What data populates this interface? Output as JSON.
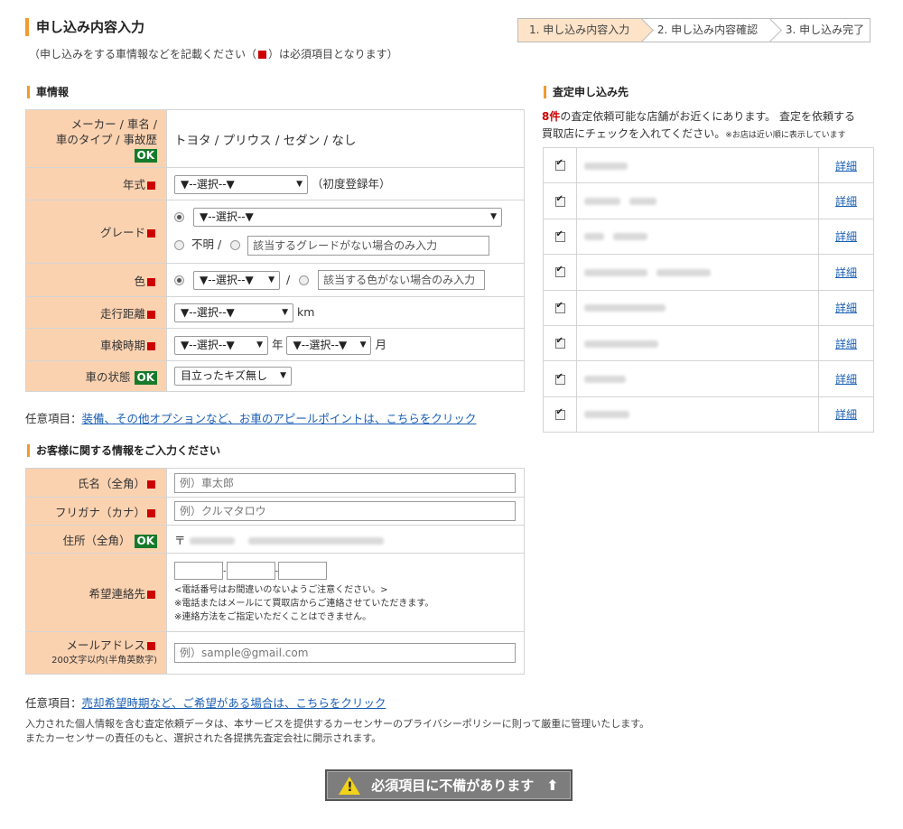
{
  "header": {
    "title": "申し込み内容入力",
    "subtitle_pre": "（申し込みをする車情報などを記載ください（",
    "subtitle_post": "）は必須項目となります）"
  },
  "steps": [
    "1. 申し込み内容入力",
    "2. 申し込み内容確認",
    "3. 申し込み完了"
  ],
  "car": {
    "section_title": "車情報",
    "maker_label_1": "メーカー / 車名 /",
    "maker_label_2": "車のタイプ / 事故歴",
    "maker_value": "トヨタ / プリウス / セダン / なし",
    "ok": "OK",
    "year_label": "年式",
    "select_placeholder": "▼--選択--▼",
    "year_note": "（初度登録年）",
    "grade_label": "グレード",
    "grade_unknown": "不明 /",
    "grade_input_placeholder": "該当するグレードがない場合のみ入力",
    "color_label": "色",
    "color_sep": "/",
    "color_input_placeholder": "該当する色がない場合のみ入力",
    "mileage_label": "走行距離",
    "mileage_unit": "km",
    "inspection_label": "車検時期",
    "year_unit": "年",
    "month_unit": "月",
    "condition_label": "車の状態",
    "condition_value": "目立ったキズ無し"
  },
  "optional1": {
    "prefix": "任意項目：",
    "link": "装備、その他オプションなど、お車のアピールポイントは、こちらをクリック"
  },
  "customer": {
    "section_title": "お客様に関する情報をご入力ください",
    "name_label": "氏名（全角）",
    "name_placeholder": "例）車太郎",
    "kana_label": "フリガナ（カナ）",
    "kana_placeholder": "例）クルマタロウ",
    "address_label": "住所（全角）",
    "postal_mark": "〒",
    "phone_label": "希望連絡先",
    "phone_note_1": "<電話番号はお間違いのないようご注意ください。>",
    "phone_note_2": "※電話またはメールにて買取店からご連絡させていただきます。",
    "phone_note_3": "※連絡方法をご指定いただくことはできません。",
    "email_label": "メールアドレス",
    "email_sublabel": "200文字以内(半角英数字)",
    "email_placeholder": "例）sample@gmail.com"
  },
  "optional2": {
    "prefix": "任意項目：",
    "link": "売却希望時期など、ご希望がある場合は、こちらをクリック"
  },
  "privacy": {
    "line1": "入力された個人情報を含む査定依頼データは、本サービスを提供するカーセンサーのプライバシーポリシーに則って厳重に管理いたします。",
    "line2": "またカーセンサーの責任のもと、選択された各提携先査定会社に開示されます。"
  },
  "stores": {
    "section_title": "査定申し込み先",
    "count": "8件",
    "intro_1": "の査定依頼可能な店舗がお近くにあります。 査定を依頼する",
    "intro_2": "買取店にチェックを入れてください。",
    "intro_small": "※お店は近い順に表示しています",
    "detail_label": "詳細",
    "rows": [
      {
        "checked": true
      },
      {
        "checked": true
      },
      {
        "checked": true
      },
      {
        "checked": true
      },
      {
        "checked": true
      },
      {
        "checked": true
      },
      {
        "checked": true
      },
      {
        "checked": true
      }
    ]
  },
  "submit": {
    "label": "必須項目に不備があります",
    "warn_glyph": "!",
    "arrow": "⬆"
  },
  "colors": {
    "accent": "#f29a2e",
    "label_bg": "#fbd2b0",
    "required": "#cc0000",
    "ok_bg": "#167a2a",
    "link": "#1a5fb4"
  }
}
